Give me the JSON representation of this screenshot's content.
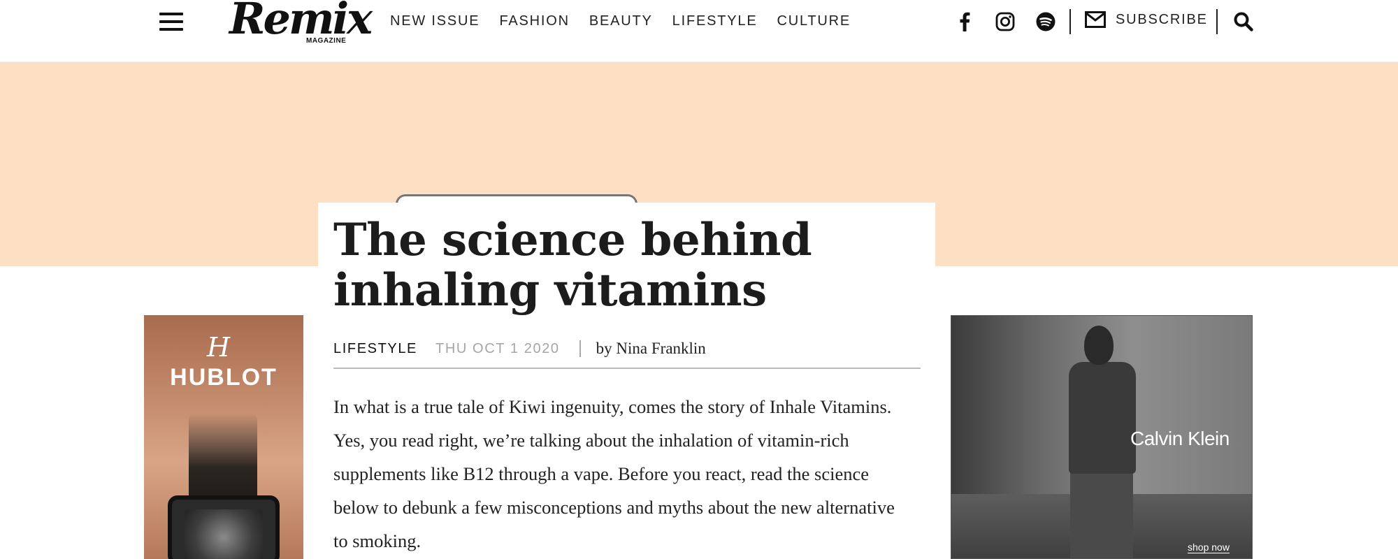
{
  "header": {
    "logo_word": "Remix",
    "logo_sub": "MAGAZINE",
    "nav": [
      "NEW ISSUE",
      "FASHION",
      "BEAUTY",
      "LIFESTYLE",
      "CULTURE"
    ],
    "subscribe_label": "SUBSCRIBE",
    "icons": [
      "menu-icon",
      "facebook-icon",
      "instagram-icon",
      "spotify-icon",
      "mail-icon",
      "search-icon"
    ]
  },
  "article": {
    "title": "The science behind inhaling vitamins",
    "category": "LIFESTYLE",
    "date": "THU OCT 1 2020",
    "author": "by Nina Franklin",
    "body": "In what is a true tale of Kiwi ingenuity, comes the story of Inhale Vitamins. Yes, you read right, we’re talking about the inhalation of vitamin-rich supplements like B12 through a vape. Before you react, read the science below to debunk a few misconceptions and myths about the new alternative to smoking."
  },
  "ads": {
    "left": {
      "mark": "H",
      "brand": "HUBLOT"
    },
    "right": {
      "brand": "Calvin Klein",
      "cta": "shop now"
    }
  },
  "colors": {
    "hero_bg": "#fde0c4",
    "text": "#1a1a1a",
    "muted": "#a6a6a6"
  }
}
